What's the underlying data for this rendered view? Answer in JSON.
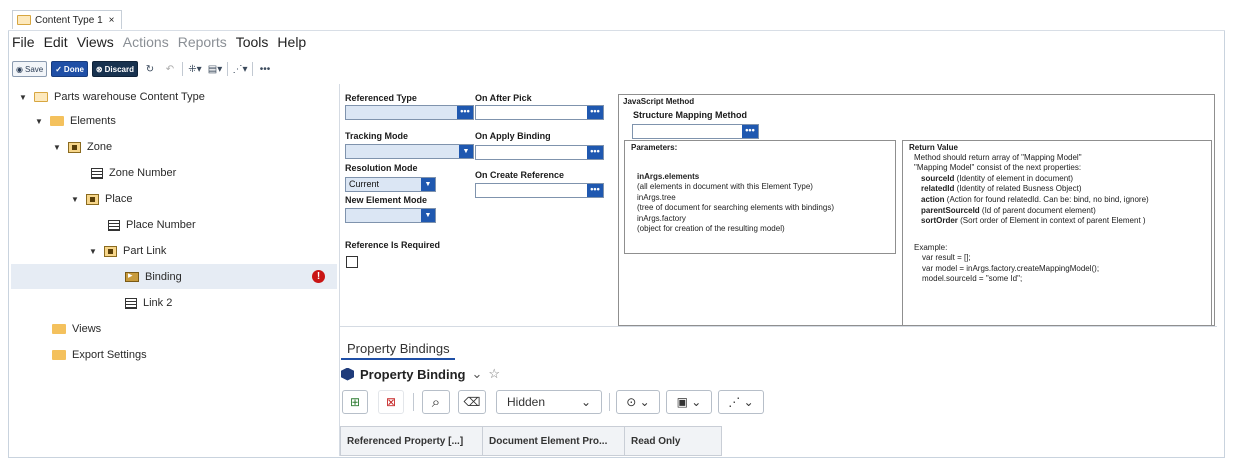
{
  "tab": {
    "title": "Content Type 1",
    "close": "×"
  },
  "menu": [
    {
      "label": "File",
      "enabled": true
    },
    {
      "label": "Edit",
      "enabled": true
    },
    {
      "label": "Views",
      "enabled": true
    },
    {
      "label": "Actions",
      "enabled": false
    },
    {
      "label": "Reports",
      "enabled": false
    },
    {
      "label": "Tools",
      "enabled": true
    },
    {
      "label": "Help",
      "enabled": true
    }
  ],
  "toolbar": {
    "save": "Save",
    "done": "Done",
    "discard": "Discard",
    "more": "•••"
  },
  "tree": {
    "root": "Parts warehouse Content Type",
    "elements": "Elements",
    "zone": "Zone",
    "zone_number": "Zone Number",
    "place": "Place",
    "place_number": "Place Number",
    "part_link": "Part Link",
    "binding": "Binding",
    "link2": "Link 2",
    "views": "Views",
    "export": "Export Settings",
    "error_badge": "!"
  },
  "form": {
    "referenced_type": "Referenced Type",
    "tracking_mode": "Tracking Mode",
    "resolution_mode": "Resolution Mode",
    "resolution_value": "Current",
    "new_element_mode": "New Element Mode",
    "reference_required": "Reference Is Required",
    "on_after_pick": "On After Pick",
    "on_apply_binding": "On Apply Binding",
    "on_create_reference": "On Create Reference",
    "dots": "•••",
    "dd": "▼"
  },
  "js": {
    "title": "JavaScript Method",
    "subtitle": "Structure Mapping Method",
    "params_header": "Parameters:",
    "params": [
      {
        "bold": "inArgs.elements",
        "text": ""
      },
      {
        "bold": "",
        "text": "(all elements in document with this Element Type)"
      },
      {
        "bold": "",
        "text": "inArgs.tree"
      },
      {
        "bold": "",
        "text": "(tree of document for searching elements with bindings)"
      },
      {
        "bold": "",
        "text": "inArgs.factory"
      },
      {
        "bold": "",
        "text": "(object for creation of the resulting model)"
      }
    ],
    "return_header": "Return Value",
    "return_lines": [
      {
        "bold": "",
        "text": "Method should return array of \"Mapping Model\""
      },
      {
        "bold": "",
        "text": "\"Mapping Model\" consist of the next properties:"
      },
      {
        "bold": "sourceId",
        "text": " (Identity of element in document)"
      },
      {
        "bold": "relatedId",
        "text": " (Identity of related Busness Object)"
      },
      {
        "bold": "action",
        "text": " (Action for found relatedId. Can be: bind, no bind, ignore)"
      },
      {
        "bold": "parentSourceId",
        "text": " (Id of parent document element)"
      },
      {
        "bold": "sortOrder",
        "text": " (Sort order of Element in context of parent Element )"
      },
      {
        "bold": "",
        "text": ""
      },
      {
        "bold": "",
        "text": "Example:"
      },
      {
        "bold": "",
        "text": "  var result = [];"
      },
      {
        "bold": "",
        "text": "  var model = inArgs.factory.createMappingModel();"
      },
      {
        "bold": "",
        "text": "  model.sourceId = \"some Id\";"
      }
    ]
  },
  "bottom": {
    "tab_label": "Property Bindings",
    "title": "Property Binding",
    "chevron": "⌄",
    "star": "☆",
    "hidden_select": "Hidden",
    "columns": [
      "Referenced Property [...]",
      "Document Element Pro...",
      "Read Only"
    ]
  },
  "colors": {
    "accent": "#1f4fa6",
    "field_bg": "#dbe6f4",
    "error": "#c91515",
    "folder": "#f4c15d"
  }
}
